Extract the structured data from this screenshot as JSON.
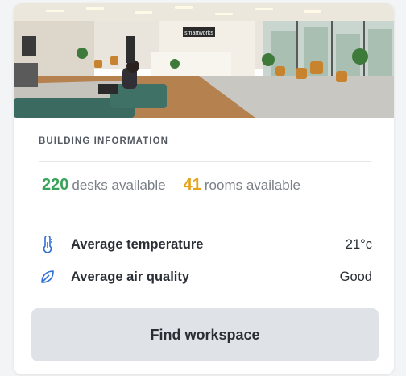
{
  "photo": {
    "sign_text": "smartworks"
  },
  "building": {
    "heading": "BUILDING INFORMATION",
    "desks_count": "220",
    "desks_label": "desks available",
    "rooms_count": "41",
    "rooms_label": "rooms available",
    "temperature": {
      "icon": "thermometer-icon",
      "label": "Average temperature",
      "value": "21°c"
    },
    "air_quality": {
      "icon": "leaf-icon",
      "label": "Average air quality",
      "value": "Good"
    }
  },
  "action": {
    "button_label": "Find workspace"
  },
  "colors": {
    "desks": "#3aa35a",
    "rooms": "#e5a21a",
    "icon": "#2f6fd6",
    "button_bg": "#dfe2e6"
  }
}
